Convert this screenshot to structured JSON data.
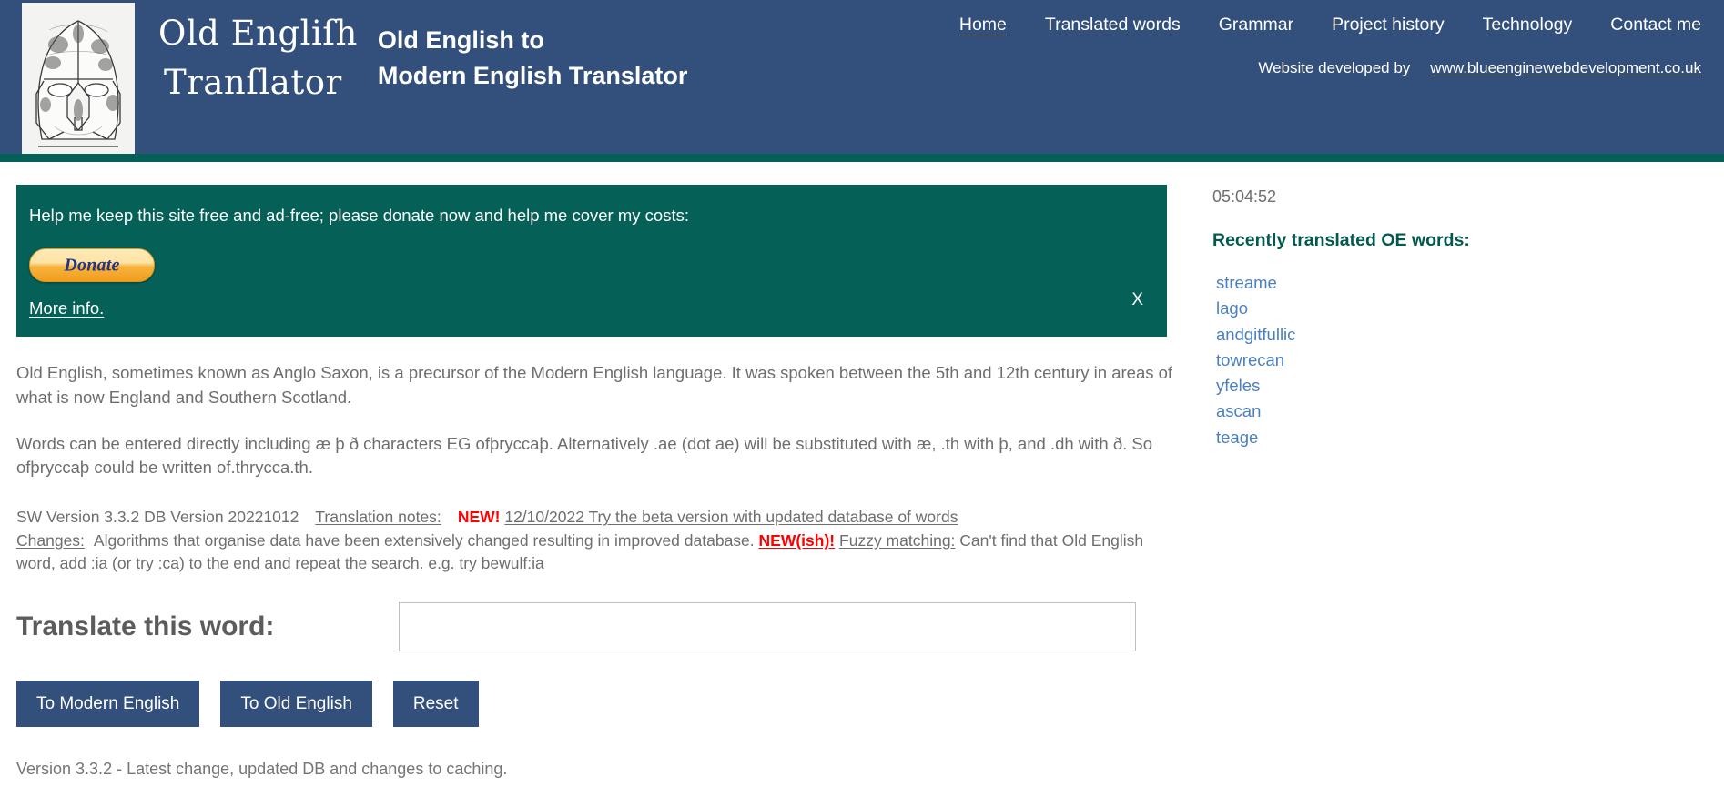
{
  "header": {
    "logo_alt": "sutton-hoo-helmet",
    "brand_oe_line1": "Old Engliſh",
    "brand_oe_line2": "Tranſlator",
    "brand_title_line1": "Old English to",
    "brand_title_line2": "Modern English Translator",
    "nav": [
      {
        "label": "Home",
        "active": true
      },
      {
        "label": "Translated words",
        "active": false
      },
      {
        "label": "Grammar",
        "active": false
      },
      {
        "label": "Project history",
        "active": false
      },
      {
        "label": "Technology",
        "active": false
      },
      {
        "label": "Contact me",
        "active": false
      }
    ],
    "developed_by_label": "Website developed by",
    "developed_by_link": "www.blueenginewebdevelopment.co.uk",
    "bg_color": "#33507d",
    "accent_color": "#056058"
  },
  "donate_banner": {
    "message": "Help me keep this site free and ad-free; please donate now and help me cover my costs:",
    "donate_button_label": "Donate",
    "more_info_label": "More info.",
    "close_label": "X",
    "bg_color": "#056058"
  },
  "main": {
    "paragraph_1": "Old English, sometimes known as Anglo Saxon, is a precursor of the Modern English language. It was spoken between the 5th and 12th century in areas of what is now England and Southern Scotland.",
    "paragraph_2": "Words can be entered directly including æ þ ð characters EG ofþryccaþ. Alternatively .ae (dot ae) will be substituted with æ, .th with þ, and .dh with ð. So ofþryccaþ could be written of.thrycca.th.",
    "notes": {
      "version_text": "SW Version 3.3.2 DB Version 20221012",
      "translation_notes_label": "Translation notes:",
      "new_flag": "NEW!",
      "beta_link": "12/10/2022 Try the beta version with updated database of words",
      "changes_label": "Changes:",
      "changes_text": "Algorithms that organise data have been extensively changed resulting in improved database.",
      "new_ish_flag": "NEW(ish)!",
      "fuzzy_label": "Fuzzy matching:",
      "fuzzy_text": "Can't find that Old English word, add :ia (or try :ca) to the end and repeat the search. e.g. try bewulf:ia",
      "new_color": "#ff0000"
    },
    "form": {
      "label": "Translate this word:",
      "input_value": "",
      "input_placeholder": "",
      "buttons": [
        {
          "label": "To Modern English"
        },
        {
          "label": "To Old English"
        },
        {
          "label": "Reset"
        }
      ],
      "button_color": "#33507d"
    },
    "footer_note": "Version 3.3.2 - Latest change, updated DB and changes to caching."
  },
  "sidebar": {
    "clock": "05:04:52",
    "heading": "Recently translated OE words:",
    "heading_color": "#04594f",
    "words": [
      "streame",
      "lago",
      "andgitfullic",
      "towrecan",
      "yfeles",
      "ascan",
      "teage"
    ],
    "word_link_color": "#4a7fc1"
  }
}
